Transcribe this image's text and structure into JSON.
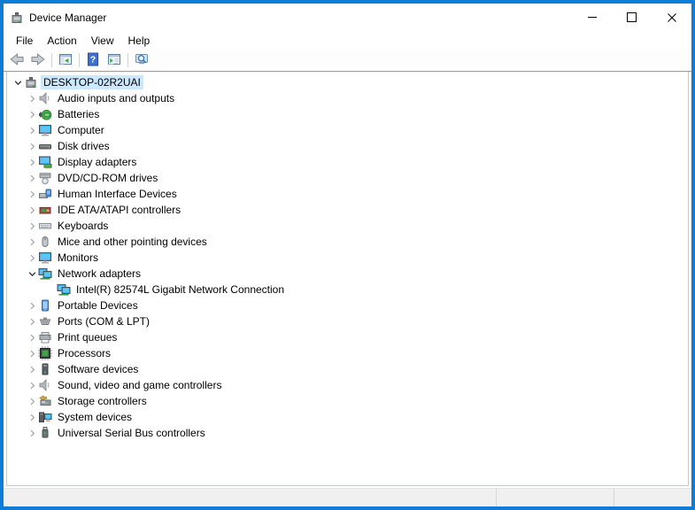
{
  "window": {
    "title": "Device Manager",
    "app_icon": "device-manager-icon",
    "controls": [
      {
        "name": "minimize-button",
        "icon": "minimize-icon"
      },
      {
        "name": "maximize-button",
        "icon": "maximize-icon"
      },
      {
        "name": "close-button",
        "icon": "close-icon"
      }
    ]
  },
  "colors": {
    "accent_border": "#0f7cd6",
    "selection": "#cce8ff",
    "statusbar_bg": "#f0f0f0",
    "toolbar_border": "#9a9a9a"
  },
  "menu": {
    "items": [
      {
        "label": "File"
      },
      {
        "label": "Action"
      },
      {
        "label": "View"
      },
      {
        "label": "Help"
      }
    ]
  },
  "toolbar": {
    "items": [
      {
        "type": "button",
        "name": "back-button",
        "icon": "back-icon"
      },
      {
        "type": "button",
        "name": "forward-button",
        "icon": "forward-icon"
      },
      {
        "type": "separator"
      },
      {
        "type": "button",
        "name": "show-hide-console-tree-button",
        "icon": "show-console-tree-icon"
      },
      {
        "type": "separator"
      },
      {
        "type": "button",
        "name": "help-button",
        "icon": "help-icon"
      },
      {
        "type": "button",
        "name": "show-hide-action-pane-button",
        "icon": "show-action-pane-icon"
      },
      {
        "type": "separator"
      },
      {
        "type": "button",
        "name": "scan-hardware-changes-button",
        "icon": "scan-hardware-changes-icon"
      }
    ]
  },
  "tree": {
    "rows": [
      {
        "label": "DESKTOP-02R2UAI",
        "icon": "computer-root-icon",
        "level": 0,
        "state": "expanded",
        "selected": true
      },
      {
        "label": "Audio inputs and outputs",
        "icon": "audio-icon",
        "level": 1,
        "state": "collapsed",
        "selected": false
      },
      {
        "label": "Batteries",
        "icon": "battery-icon",
        "level": 1,
        "state": "collapsed",
        "selected": false
      },
      {
        "label": "Computer",
        "icon": "monitor-icon",
        "level": 1,
        "state": "collapsed",
        "selected": false
      },
      {
        "label": "Disk drives",
        "icon": "disk-drive-icon",
        "level": 1,
        "state": "collapsed",
        "selected": false
      },
      {
        "label": "Display adapters",
        "icon": "display-adapter-icon",
        "level": 1,
        "state": "collapsed",
        "selected": false
      },
      {
        "label": "DVD/CD-ROM drives",
        "icon": "dvd-drive-icon",
        "level": 1,
        "state": "collapsed",
        "selected": false
      },
      {
        "label": "Human Interface Devices",
        "icon": "hid-icon",
        "level": 1,
        "state": "collapsed",
        "selected": false
      },
      {
        "label": "IDE ATA/ATAPI controllers",
        "icon": "ide-controller-icon",
        "level": 1,
        "state": "collapsed",
        "selected": false
      },
      {
        "label": "Keyboards",
        "icon": "keyboard-icon",
        "level": 1,
        "state": "collapsed",
        "selected": false
      },
      {
        "label": "Mice and other pointing devices",
        "icon": "mouse-icon",
        "level": 1,
        "state": "collapsed",
        "selected": false
      },
      {
        "label": "Monitors",
        "icon": "monitor-icon",
        "level": 1,
        "state": "collapsed",
        "selected": false
      },
      {
        "label": "Network adapters",
        "icon": "network-adapter-icon",
        "level": 1,
        "state": "expanded",
        "selected": false
      },
      {
        "label": "Intel(R) 82574L Gigabit Network Connection",
        "icon": "network-connection-icon",
        "level": 2,
        "state": "leaf",
        "selected": false
      },
      {
        "label": "Portable Devices",
        "icon": "portable-device-icon",
        "level": 1,
        "state": "collapsed",
        "selected": false
      },
      {
        "label": "Ports (COM & LPT)",
        "icon": "ports-icon",
        "level": 1,
        "state": "collapsed",
        "selected": false
      },
      {
        "label": "Print queues",
        "icon": "printer-icon",
        "level": 1,
        "state": "collapsed",
        "selected": false
      },
      {
        "label": "Processors",
        "icon": "processor-icon",
        "level": 1,
        "state": "collapsed",
        "selected": false
      },
      {
        "label": "Software devices",
        "icon": "software-device-icon",
        "level": 1,
        "state": "collapsed",
        "selected": false
      },
      {
        "label": "Sound, video and game controllers",
        "icon": "sound-icon",
        "level": 1,
        "state": "collapsed",
        "selected": false
      },
      {
        "label": "Storage controllers",
        "icon": "storage-controller-icon",
        "level": 1,
        "state": "collapsed",
        "selected": false
      },
      {
        "label": "System devices",
        "icon": "system-devices-icon",
        "level": 1,
        "state": "collapsed",
        "selected": false
      },
      {
        "label": "Universal Serial Bus controllers",
        "icon": "usb-icon",
        "level": 1,
        "state": "collapsed",
        "selected": false
      }
    ]
  },
  "statusbar": {
    "panels": [
      "",
      "",
      ""
    ]
  }
}
